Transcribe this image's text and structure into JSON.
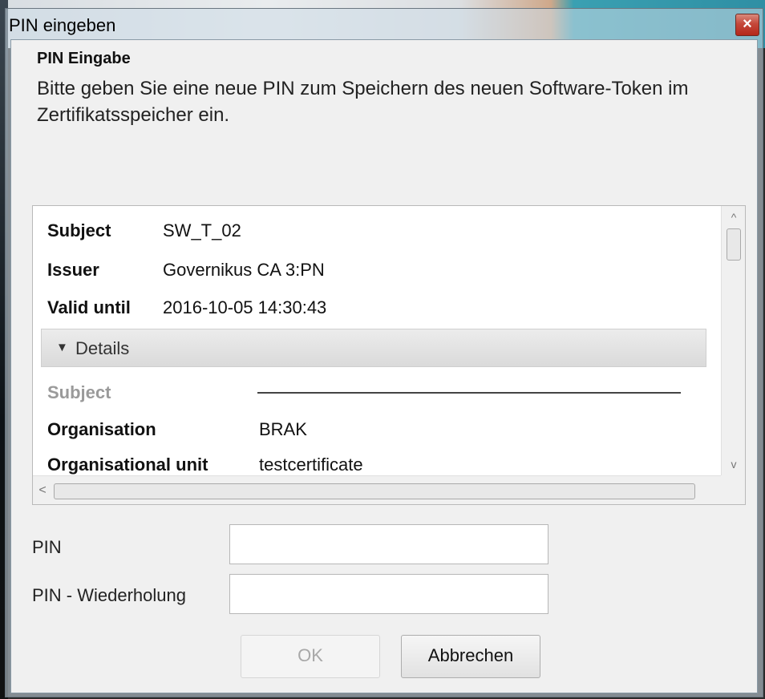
{
  "window": {
    "title": "PIN eingeben",
    "close_symbol": "×"
  },
  "header": {
    "heading": "PIN Eingabe",
    "description": "Bitte geben Sie eine neue PIN zum Speichern des neuen Software-Token im Zertifikatsspeicher ein."
  },
  "certificate": {
    "summary": [
      {
        "label": "Subject",
        "value": "SW_T_02"
      },
      {
        "label": "Issuer",
        "value": "Governikus CA 3:PN"
      },
      {
        "label": "Valid until",
        "value": "2016-10-05 14:30:43"
      }
    ],
    "details": {
      "toggle_icon": "▼",
      "toggle_label": "Details",
      "section_label": "Subject",
      "rows": [
        {
          "label": "Organisation",
          "value": "BRAK"
        },
        {
          "label": "Organisational unit",
          "value": "testcertificate"
        }
      ]
    },
    "scrollbar": {
      "up_icon": "^",
      "down_icon": "v",
      "left_icon": "<",
      "right_icon": ">"
    }
  },
  "form": {
    "pin_label": "PIN",
    "pin_value": "",
    "pin_repeat_label": "PIN - Wiederholung",
    "pin_repeat_value": ""
  },
  "buttons": {
    "ok_label": "OK",
    "ok_enabled": false,
    "cancel_label": "Abbrechen"
  },
  "colors": {
    "close_button": "#c5483a",
    "dialog_background": "#f0f0f0",
    "disabled_text": "#a8a8a8"
  }
}
